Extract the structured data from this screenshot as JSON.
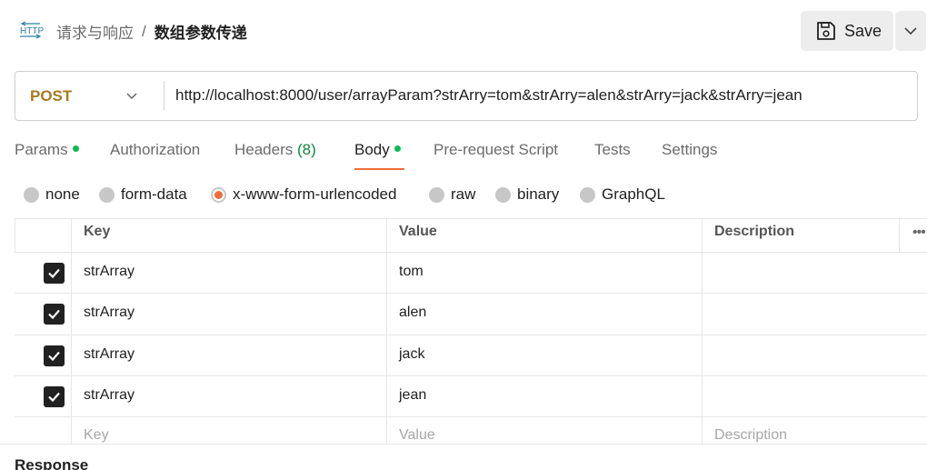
{
  "header": {
    "breadcrumb_parent": "请求与响应",
    "breadcrumb_separator": "/",
    "breadcrumb_current": "数组参数传递",
    "save_label": "Save",
    "http_icon_text": "HTTP"
  },
  "request": {
    "method": "POST",
    "url": "http://localhost:8000/user/arrayParam?strArry=tom&strArry=alen&strArry=jack&strArry=jean"
  },
  "tabs": [
    {
      "label": "Params",
      "has_dot": true
    },
    {
      "label": "Authorization"
    },
    {
      "label": "Headers",
      "count": "(8)"
    },
    {
      "label": "Body",
      "has_dot": true,
      "active": true
    },
    {
      "label": "Pre-request Script"
    },
    {
      "label": "Tests"
    },
    {
      "label": "Settings"
    }
  ],
  "body_types": [
    {
      "label": "none"
    },
    {
      "label": "form-data"
    },
    {
      "label": "x-www-form-urlencoded",
      "selected": true
    },
    {
      "label": "raw"
    },
    {
      "label": "binary"
    },
    {
      "label": "GraphQL"
    }
  ],
  "table": {
    "columns": [
      "Key",
      "Value",
      "Description"
    ],
    "rows": [
      {
        "checked": true,
        "key": "strArray",
        "value": "tom",
        "description": ""
      },
      {
        "checked": true,
        "key": "strArray",
        "value": "alen",
        "description": ""
      },
      {
        "checked": true,
        "key": "strArray",
        "value": "jack",
        "description": ""
      },
      {
        "checked": true,
        "key": "strArray",
        "value": "jean",
        "description": ""
      }
    ],
    "placeholders": {
      "key": "Key",
      "value": "Value",
      "description": "Description"
    },
    "more_icon": "ellipsis-icon"
  },
  "response": {
    "label": "Response"
  },
  "colors": {
    "method": "#a67b1f",
    "accent": "#f26b3a",
    "dot_green": "#0cbb52",
    "count_green": "#0b8a3e",
    "button_bg": "#ededed"
  }
}
